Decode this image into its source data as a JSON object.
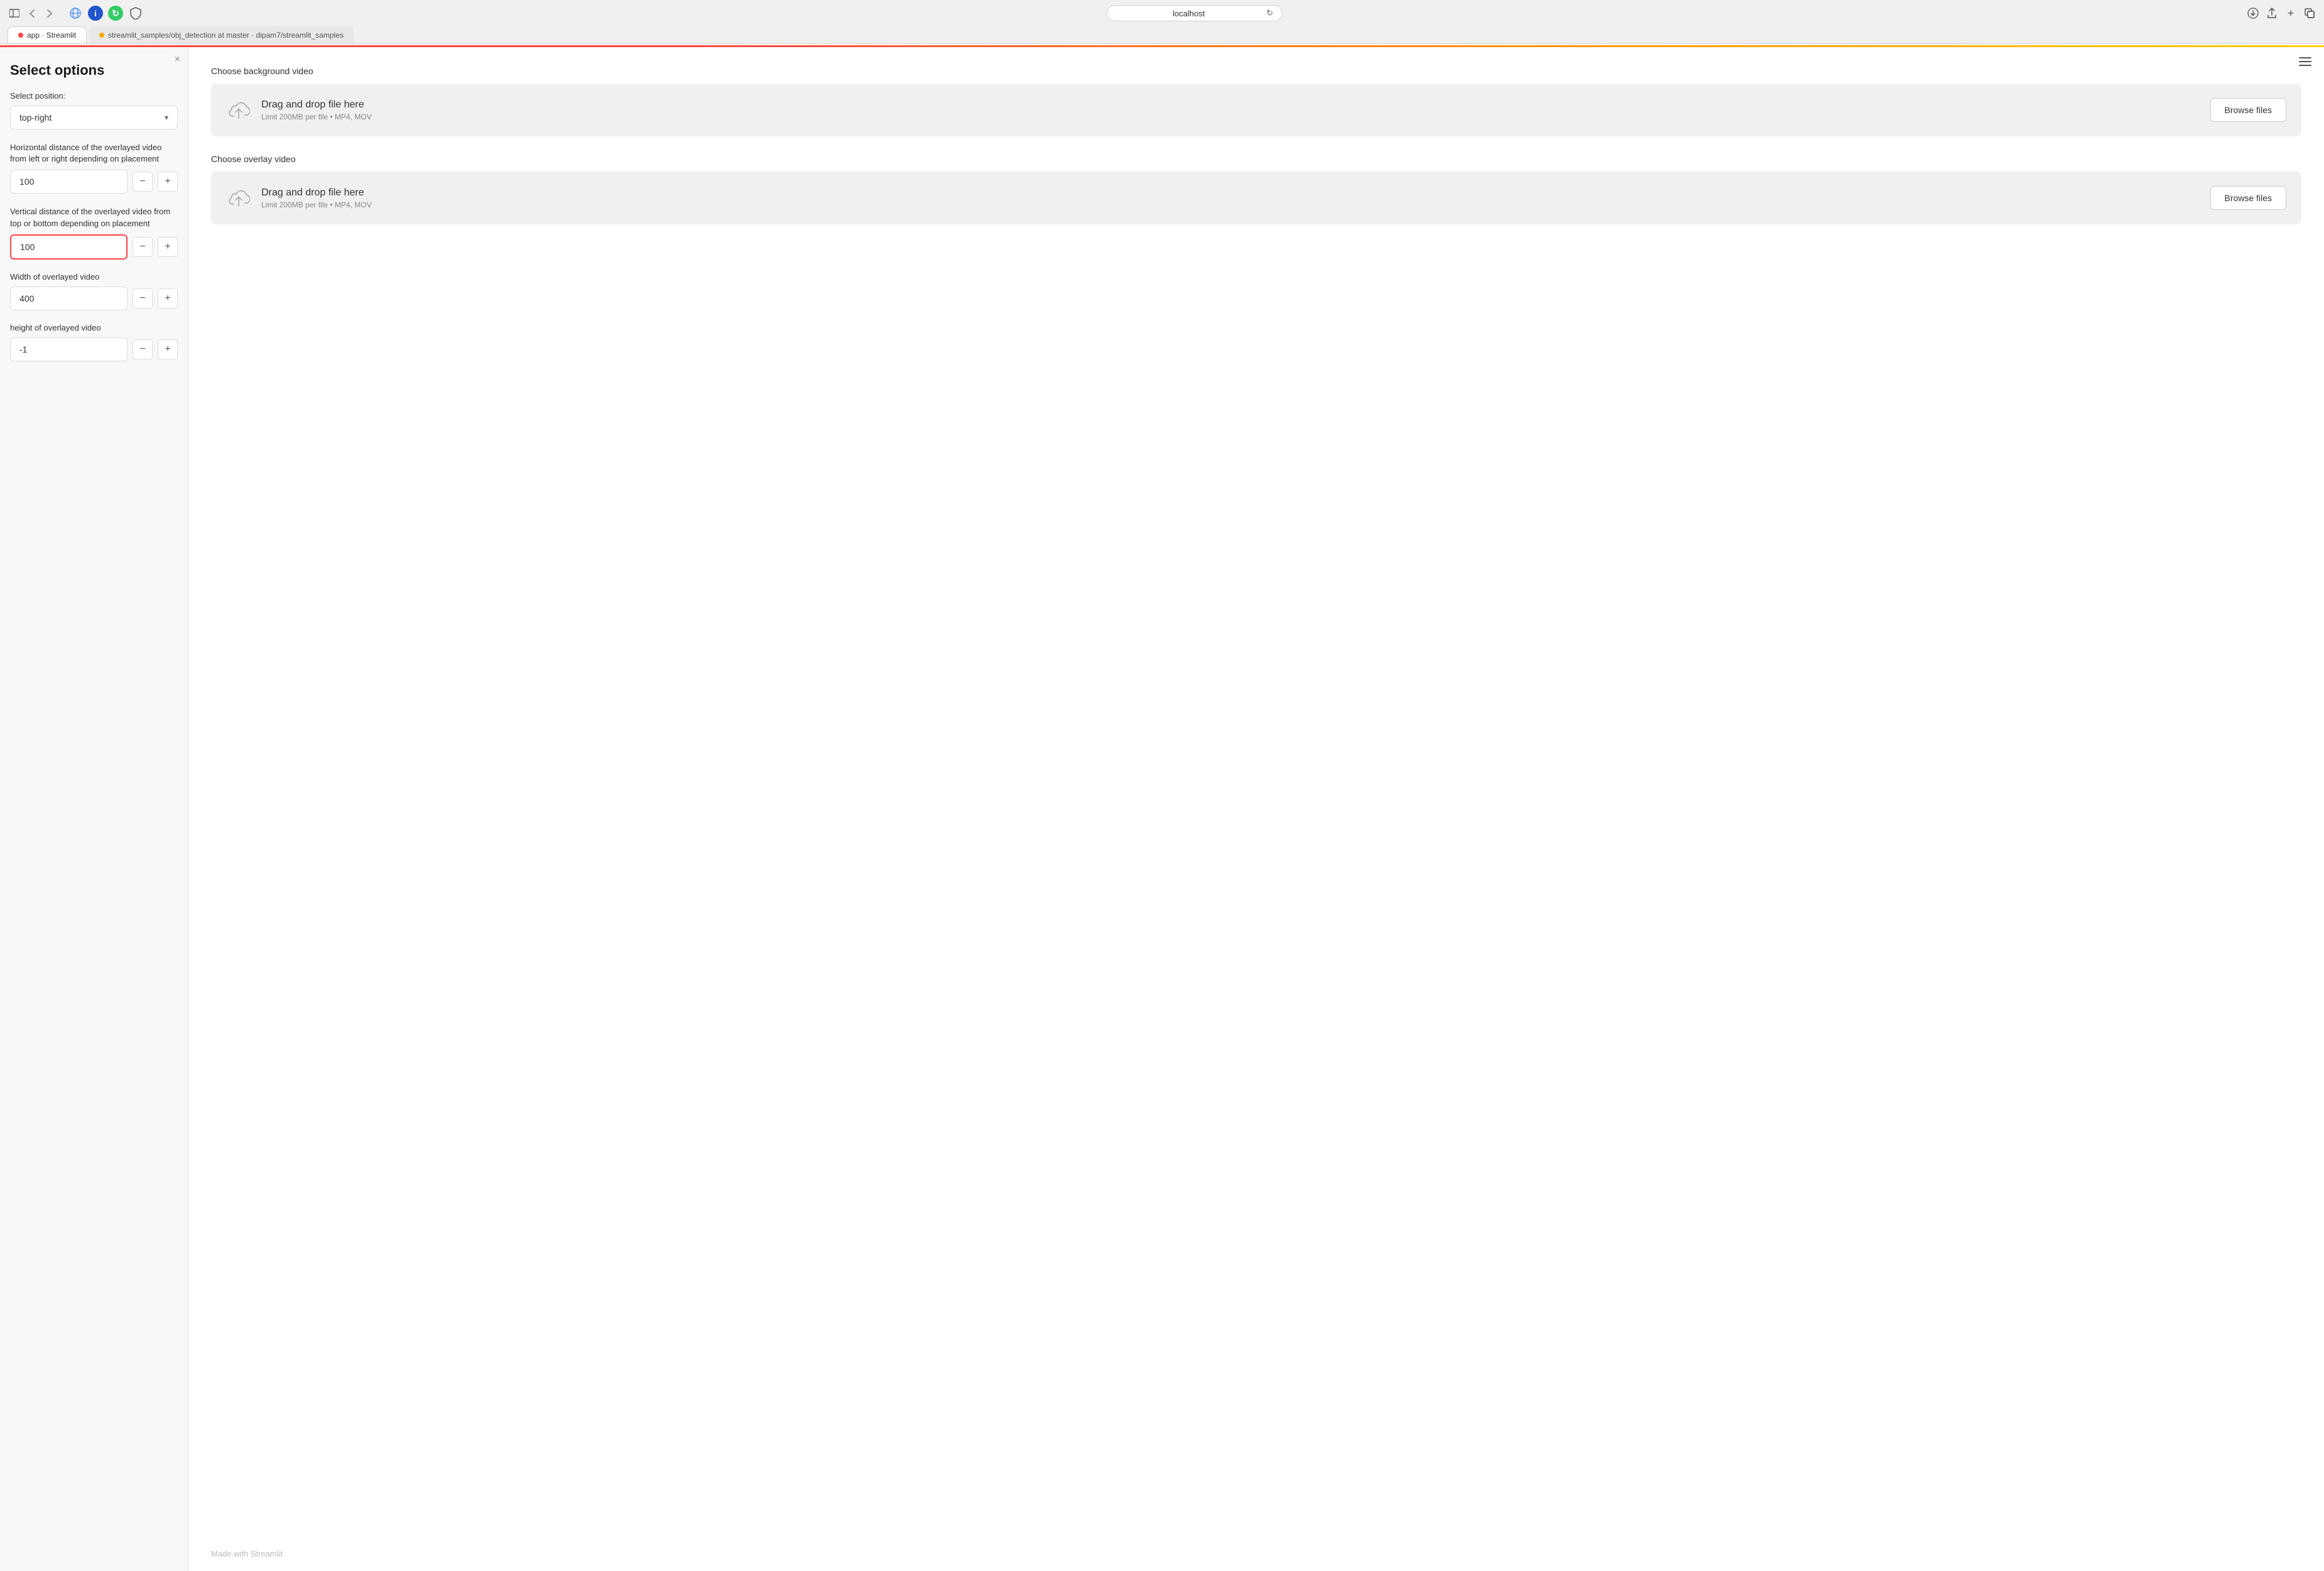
{
  "browser": {
    "address": "localhost",
    "tab1_label": "app · Streamlit",
    "tab2_label": "streamlit_samples/obj_detection at master · dipam7/streamlit_samples",
    "tab1_dot_color": "#ff4444",
    "tab2_dot_color": "#ffaa00"
  },
  "sidebar": {
    "title": "Select options",
    "close_label": "×",
    "position_label": "Select position:",
    "position_value": "top-right",
    "h_dist_label": "Horizontal distance of the overlayed video from left or right depending on placement",
    "h_dist_value": "100",
    "v_dist_label": "Vertical distance of the overlayed video from top or bottom depending on placement",
    "v_dist_value": "100",
    "width_label": "Width of overlayed video",
    "width_value": "400",
    "height_label": "height of overlayed video",
    "height_value": "-1",
    "minus_label": "−",
    "plus_label": "+"
  },
  "main": {
    "hamburger_aria": "menu",
    "section1_label": "Choose background video",
    "upload1_main": "Drag and drop file here",
    "upload1_sub": "Limit 200MB per file • MP4, MOV",
    "browse1_label": "Browse files",
    "section2_label": "Choose overlay video",
    "upload2_main": "Drag and drop file here",
    "upload2_sub": "Limit 200MB per file • MP4, MOV",
    "browse2_label": "Browse files",
    "footer": "Made with Streamlit"
  },
  "topbar": {
    "gradient": "linear-gradient(to right, #ff4444 30%, #ff8800 60%, #ffcc00 100%)"
  }
}
